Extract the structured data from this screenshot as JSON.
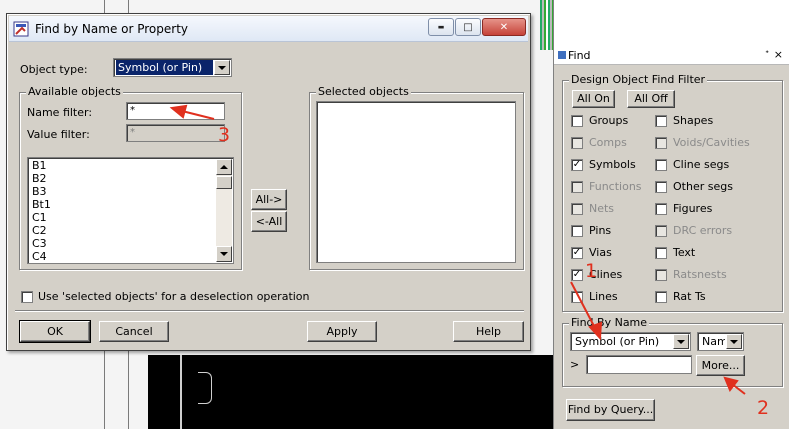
{
  "dialog": {
    "title": "Find by Name or Property",
    "object_type_label": "Object type:",
    "object_type_value": "Symbol (or Pin)",
    "available_objects_title": "Available objects",
    "name_filter_label": "Name filter:",
    "name_filter_value": "*",
    "value_filter_label": "Value filter:",
    "value_filter_value": "*",
    "list_items": [
      "B1",
      "B2",
      "B3",
      "Bt1",
      "C1",
      "C2",
      "C3",
      "C4"
    ],
    "all_right_label": "All->",
    "all_left_label": "<-All",
    "selected_objects_title": "Selected objects",
    "deselect_option_label": "Use 'selected objects' for a deselection operation",
    "ok_label": "OK",
    "cancel_label": "Cancel",
    "apply_label": "Apply",
    "help_label": "Help",
    "window_buttons": {
      "minimize": "▬",
      "maximize": "□",
      "close": "✕"
    }
  },
  "find_panel": {
    "title": "Find",
    "pin_icon": "pin-icon",
    "close_glyph": "×",
    "filter_title": "Design Object Find Filter",
    "all_on_label": "All On",
    "all_off_label": "All Off",
    "left_options": [
      {
        "label": "Groups",
        "checked": false,
        "enabled": true
      },
      {
        "label": "Comps",
        "checked": false,
        "enabled": false
      },
      {
        "label": "Symbols",
        "checked": true,
        "enabled": true
      },
      {
        "label": "Functions",
        "checked": false,
        "enabled": false
      },
      {
        "label": "Nets",
        "checked": false,
        "enabled": false
      },
      {
        "label": "Pins",
        "checked": false,
        "enabled": true
      },
      {
        "label": "Vias",
        "checked": true,
        "enabled": true
      },
      {
        "label": "Clines",
        "checked": true,
        "enabled": true
      },
      {
        "label": "Lines",
        "checked": false,
        "enabled": true
      }
    ],
    "right_options": [
      {
        "label": "Shapes",
        "checked": false,
        "enabled": true
      },
      {
        "label": "Voids/Cavities",
        "checked": false,
        "enabled": false
      },
      {
        "label": "Cline segs",
        "checked": false,
        "enabled": true
      },
      {
        "label": "Other segs",
        "checked": false,
        "enabled": true
      },
      {
        "label": "Figures",
        "checked": false,
        "enabled": true
      },
      {
        "label": "DRC errors",
        "checked": false,
        "enabled": false
      },
      {
        "label": "Text",
        "checked": false,
        "enabled": true
      },
      {
        "label": "Ratsnests",
        "checked": false,
        "enabled": false
      },
      {
        "label": "Rat Ts",
        "checked": false,
        "enabled": true
      }
    ],
    "find_by_name_title": "Find By Name",
    "type_value": "Symbol (or Pin)",
    "mode_value": "Name",
    "prompt_glyph": ">",
    "name_input_value": "",
    "more_label": "More...",
    "find_by_query_label": "Find by Query..."
  },
  "annotations": {
    "labels": [
      "1",
      "2",
      "3"
    ],
    "color": "#e0301e"
  },
  "colors": {
    "dialog_face": "#d4d0c8",
    "selection": "#0a246a",
    "pcb_canvas": "#000000"
  }
}
